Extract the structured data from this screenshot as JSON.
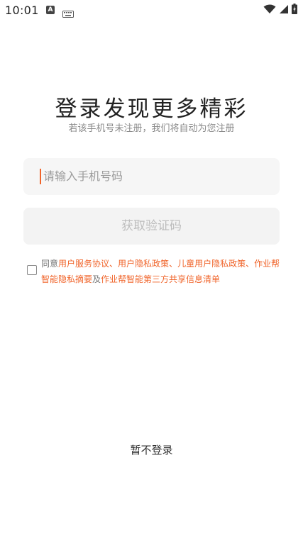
{
  "status_bar": {
    "time": "10:01",
    "app_icon_letter": "A",
    "icons": [
      "app-notification-icon",
      "keyboard-icon",
      "wifi-icon",
      "signal-icon",
      "battery-charging-icon"
    ]
  },
  "login": {
    "title": "登录发现更多精彩",
    "subtitle": "若该手机号未注册，我们将自动为您注册",
    "phone_placeholder": "请输入手机号码",
    "get_code_label": "获取验证码",
    "agreement": {
      "prefix": "同意",
      "link1": "用户服务协议",
      "sep1": "、",
      "link2": "用户隐私政策",
      "sep2": "、",
      "link3": "儿童用户隐私政策",
      "sep3": "、",
      "link4": "作业帮智能隐私摘要",
      "and": "及",
      "link5": "作业帮智能第三方共享信息清单"
    },
    "skip_label": "暂不登录"
  },
  "colors": {
    "accent": "#f0642a",
    "input_bg": "#f6f6f6",
    "button_bg": "#f3f3f3",
    "button_text": "#bdbdbd"
  }
}
